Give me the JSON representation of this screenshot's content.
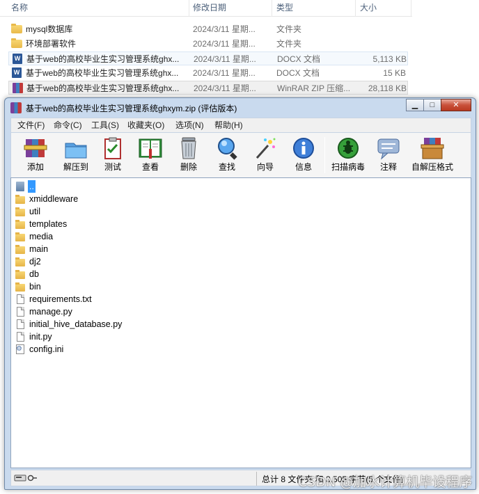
{
  "explorer": {
    "columns": {
      "name": "名称",
      "modified": "修改日期",
      "type": "类型",
      "size": "大小"
    },
    "rows": [
      {
        "name": "mysql数据库",
        "modified": "2024/3/11 星期...",
        "type": "文件夹",
        "size": "",
        "icon": "folder-icon"
      },
      {
        "name": "环境部署软件",
        "modified": "2024/3/11 星期...",
        "type": "文件夹",
        "size": "",
        "icon": "folder-icon"
      },
      {
        "name": "基于web的高校毕业生实习管理系统ghx...",
        "modified": "2024/3/11 星期...",
        "type": "DOCX 文档",
        "size": "5,113 KB",
        "icon": "word-document-icon"
      },
      {
        "name": "基于web的高校毕业生实习管理系统ghx...",
        "modified": "2024/3/11 星期...",
        "type": "DOCX 文档",
        "size": "15 KB",
        "icon": "word-document-icon"
      },
      {
        "name": "基于web的高校毕业生实习管理系统ghx...",
        "modified": "2024/3/11 星期...",
        "type": "WinRAR ZIP 压缩...",
        "size": "28,118 KB",
        "icon": "winrar-archive-icon"
      }
    ]
  },
  "winrar": {
    "title": "基于web的高校毕业生实习管理系统ghxym.zip (评估版本)",
    "caption": {
      "minimize": "▁",
      "maximize": "□",
      "close": "✕"
    },
    "menu": [
      "文件(F)",
      "命令(C)",
      "工具(S)",
      "收藏夹(O)",
      "选项(N)",
      "帮助(H)"
    ],
    "toolbar": [
      {
        "label": "添加",
        "icon": "add-archive-icon"
      },
      {
        "label": "解压到",
        "icon": "extract-to-icon"
      },
      {
        "label": "测试",
        "icon": "test-icon"
      },
      {
        "label": "查看",
        "icon": "view-book-icon"
      },
      {
        "label": "删除",
        "icon": "trash-icon"
      },
      {
        "label": "查找",
        "icon": "find-magnifier-icon"
      },
      {
        "label": "向导",
        "icon": "wizard-wand-icon"
      },
      {
        "label": "信息",
        "icon": "info-icon"
      },
      {
        "label": "扫描病毒",
        "icon": "virus-scan-icon"
      },
      {
        "label": "注释",
        "icon": "comment-icon"
      },
      {
        "label": "自解压格式",
        "icon": "sfx-box-icon"
      }
    ],
    "files": [
      {
        "name": "..",
        "kind": "up"
      },
      {
        "name": "xmiddleware",
        "kind": "folder"
      },
      {
        "name": "util",
        "kind": "folder"
      },
      {
        "name": "templates",
        "kind": "folder"
      },
      {
        "name": "media",
        "kind": "folder"
      },
      {
        "name": "main",
        "kind": "folder"
      },
      {
        "name": "dj2",
        "kind": "folder"
      },
      {
        "name": "db",
        "kind": "folder"
      },
      {
        "name": "bin",
        "kind": "folder"
      },
      {
        "name": "requirements.txt",
        "kind": "file"
      },
      {
        "name": "manage.py",
        "kind": "file"
      },
      {
        "name": "initial_hive_database.py",
        "kind": "file"
      },
      {
        "name": "init.py",
        "kind": "file"
      },
      {
        "name": "config.ini",
        "kind": "config"
      }
    ],
    "status": "总计 8 文件夹 和 3,505 字节(5 个文件)"
  },
  "watermark": "CSDN @加水计算机毕设程序"
}
